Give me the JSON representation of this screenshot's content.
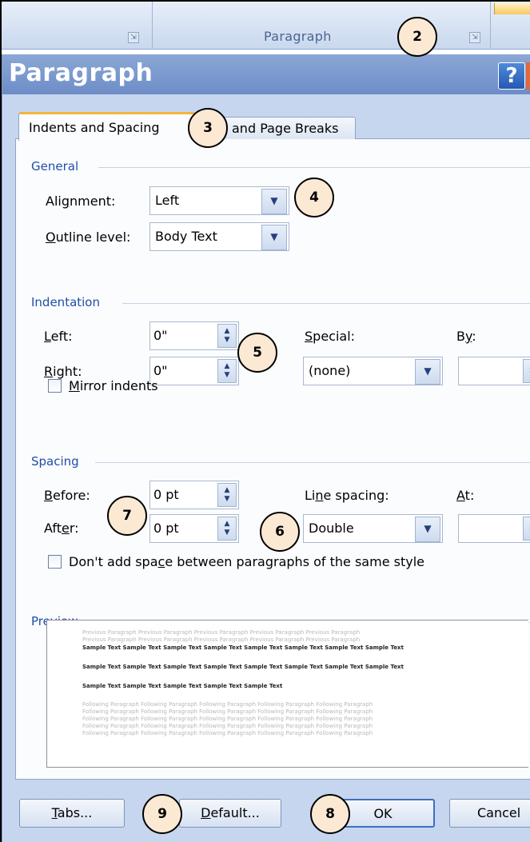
{
  "ribbon": {
    "group_label": "Paragraph",
    "launcher_glyph": "⇲"
  },
  "dialog": {
    "title": "Paragraph",
    "help_glyph": "?",
    "tabs": [
      {
        "label": "Indents and Spacing",
        "active": true
      },
      {
        "label_visible": "and Page Breaks",
        "active": false
      }
    ],
    "general": {
      "heading": "General",
      "alignment_label": "Alignment:",
      "alignment_value": "Left",
      "outline_label": "Outline level:",
      "outline_value": "Body Text"
    },
    "indentation": {
      "heading": "Indentation",
      "left_label": "Left:",
      "left_value": "0\"",
      "right_label": "Right:",
      "right_value": "0\"",
      "special_label": "Special:",
      "special_value": "(none)",
      "by_label": "By:",
      "by_value": "",
      "mirror_label": "Mirror indents",
      "mirror_checked": false
    },
    "spacing": {
      "heading": "Spacing",
      "before_label": "Before:",
      "before_value": "0 pt",
      "after_label": "After:",
      "after_value": "0 pt",
      "line_spacing_label": "Line spacing:",
      "line_spacing_value": "Double",
      "at_label": "At:",
      "at_value": "",
      "dont_add_label": "Don't add space between paragraphs of the same style",
      "dont_add_checked": false
    },
    "preview": {
      "heading": "Preview",
      "previous_lines": [
        "Previous Paragraph Previous Paragraph Previous Paragraph Previous Paragraph Previous Paragraph",
        "Previous Paragraph Previous Paragraph Previous Paragraph Previous Paragraph Previous Paragraph"
      ],
      "sample_lines": [
        "Sample Text Sample Text Sample Text Sample Text Sample Text Sample Text Sample Text Sample Text",
        "Sample Text Sample Text Sample Text Sample Text Sample Text Sample Text Sample Text Sample Text",
        "Sample Text Sample Text Sample Text Sample Text Sample Text"
      ],
      "following_lines": [
        "Following Paragraph Following Paragraph Following Paragraph Following Paragraph Following Paragraph",
        "Following Paragraph Following Paragraph Following Paragraph Following Paragraph Following Paragraph",
        "Following Paragraph Following Paragraph Following Paragraph Following Paragraph Following Paragraph",
        "Following Paragraph Following Paragraph Following Paragraph Following Paragraph Following Paragraph",
        "Following Paragraph Following Paragraph Following Paragraph Following Paragraph Following Paragraph"
      ]
    },
    "buttons": {
      "tabs": "Tabs...",
      "default": "Default...",
      "ok": "OK",
      "cancel": "Cancel"
    }
  },
  "callouts": [
    "2",
    "3",
    "4",
    "5",
    "6",
    "7",
    "8",
    "9"
  ]
}
